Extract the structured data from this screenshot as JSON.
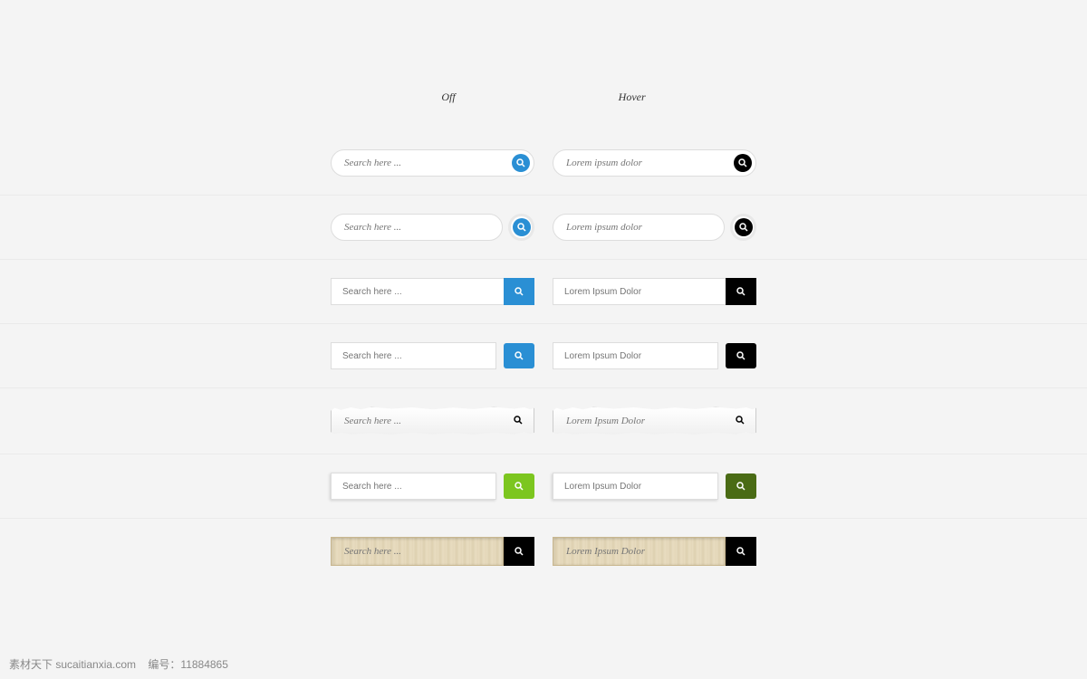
{
  "headers": {
    "off": "Off",
    "hover": "Hover"
  },
  "placeholders": {
    "off": "Search here ...",
    "hover_italic": "Lorem ipsum dolor",
    "hover_caps": "Lorem Ipsum Dolor"
  },
  "footer": {
    "site": "素材天下 sucaitianxia.com",
    "id_label": "编号：",
    "id_value": "11884865"
  },
  "icons": {
    "search": "search-icon"
  }
}
